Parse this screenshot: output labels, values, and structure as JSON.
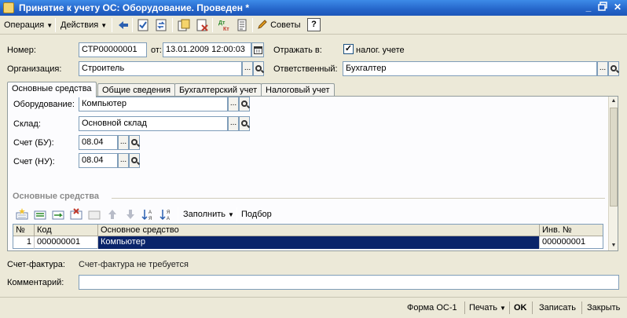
{
  "window": {
    "title": "Принятие к учету ОС: Оборудование. Проведен *"
  },
  "toolbar": {
    "operation": "Операция",
    "actions": "Действия",
    "tips": "Советы",
    "help": "?"
  },
  "header": {
    "number_label": "Номер:",
    "number_value": "СТР00000001",
    "date_label": "от:",
    "date_value": "13.01.2009 12:00:03",
    "reflect_label": "Отражать в:",
    "tax_checkbox_label": "налог. учете",
    "org_label": "Организация:",
    "org_value": "Строитель",
    "resp_label": "Ответственный:",
    "resp_value": "Бухгалтер"
  },
  "tabs": [
    {
      "label": "Основные средства",
      "active": true
    },
    {
      "label": "Общие сведения",
      "active": false
    },
    {
      "label": "Бухгалтерский учет",
      "active": false
    },
    {
      "label": "Налоговый учет",
      "active": false
    }
  ],
  "main_tab": {
    "equipment_label": "Оборудование:",
    "equipment_value": "Компьютер",
    "warehouse_label": "Склад:",
    "warehouse_value": "Основной склад",
    "account_bu_label": "Счет (БУ):",
    "account_bu_value": "08.04",
    "account_nu_label": "Счет (НУ):",
    "account_nu_value": "08.04",
    "section_title": "Основные средства",
    "fill_label": "Заполнить",
    "pick_label": "Подбор"
  },
  "table": {
    "columns": [
      "№",
      "Код",
      "Основное средство",
      "Инв. №"
    ],
    "rows": [
      {
        "n": "1",
        "code": "000000001",
        "asset": "Компьютер",
        "inv": "000000001"
      }
    ]
  },
  "footer": {
    "invoice_label": "Счет-фактура:",
    "invoice_value": "Счет-фактура не требуется",
    "comment_label": "Комментарий:",
    "comment_value": ""
  },
  "statusbar": {
    "form_os1": "Форма ОС-1",
    "print": "Печать",
    "ok": "OK",
    "save": "Записать",
    "close": "Закрыть"
  }
}
